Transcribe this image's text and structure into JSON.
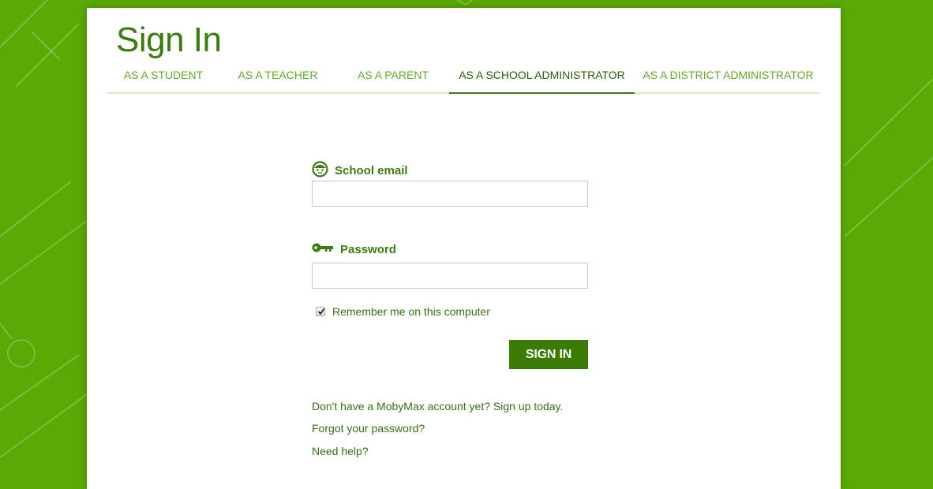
{
  "page": {
    "title": "Sign In"
  },
  "tabs": [
    {
      "label": "AS A STUDENT"
    },
    {
      "label": "AS A TEACHER"
    },
    {
      "label": "AS A PARENT"
    },
    {
      "label": "AS A SCHOOL ADMINISTRATOR",
      "active": true
    },
    {
      "label": "AS A DISTRICT ADMINISTRATOR"
    }
  ],
  "form": {
    "email_label": "School email",
    "email_icon": "face-icon",
    "email_value": "",
    "password_label": "Password",
    "password_icon": "key-icon",
    "password_value": "",
    "remember_label": "Remember me on this computer",
    "remember_checked": true,
    "submit_label": "SIGN IN"
  },
  "links": {
    "signup": "Don't have a MobyMax account yet? Sign up today.",
    "forgot": "Forgot your password?",
    "help": "Need help?"
  },
  "colors": {
    "background": "#5aaa06",
    "brand_green": "#3c7b10",
    "tab_green": "#62a82a",
    "button": "#3b7a05"
  }
}
